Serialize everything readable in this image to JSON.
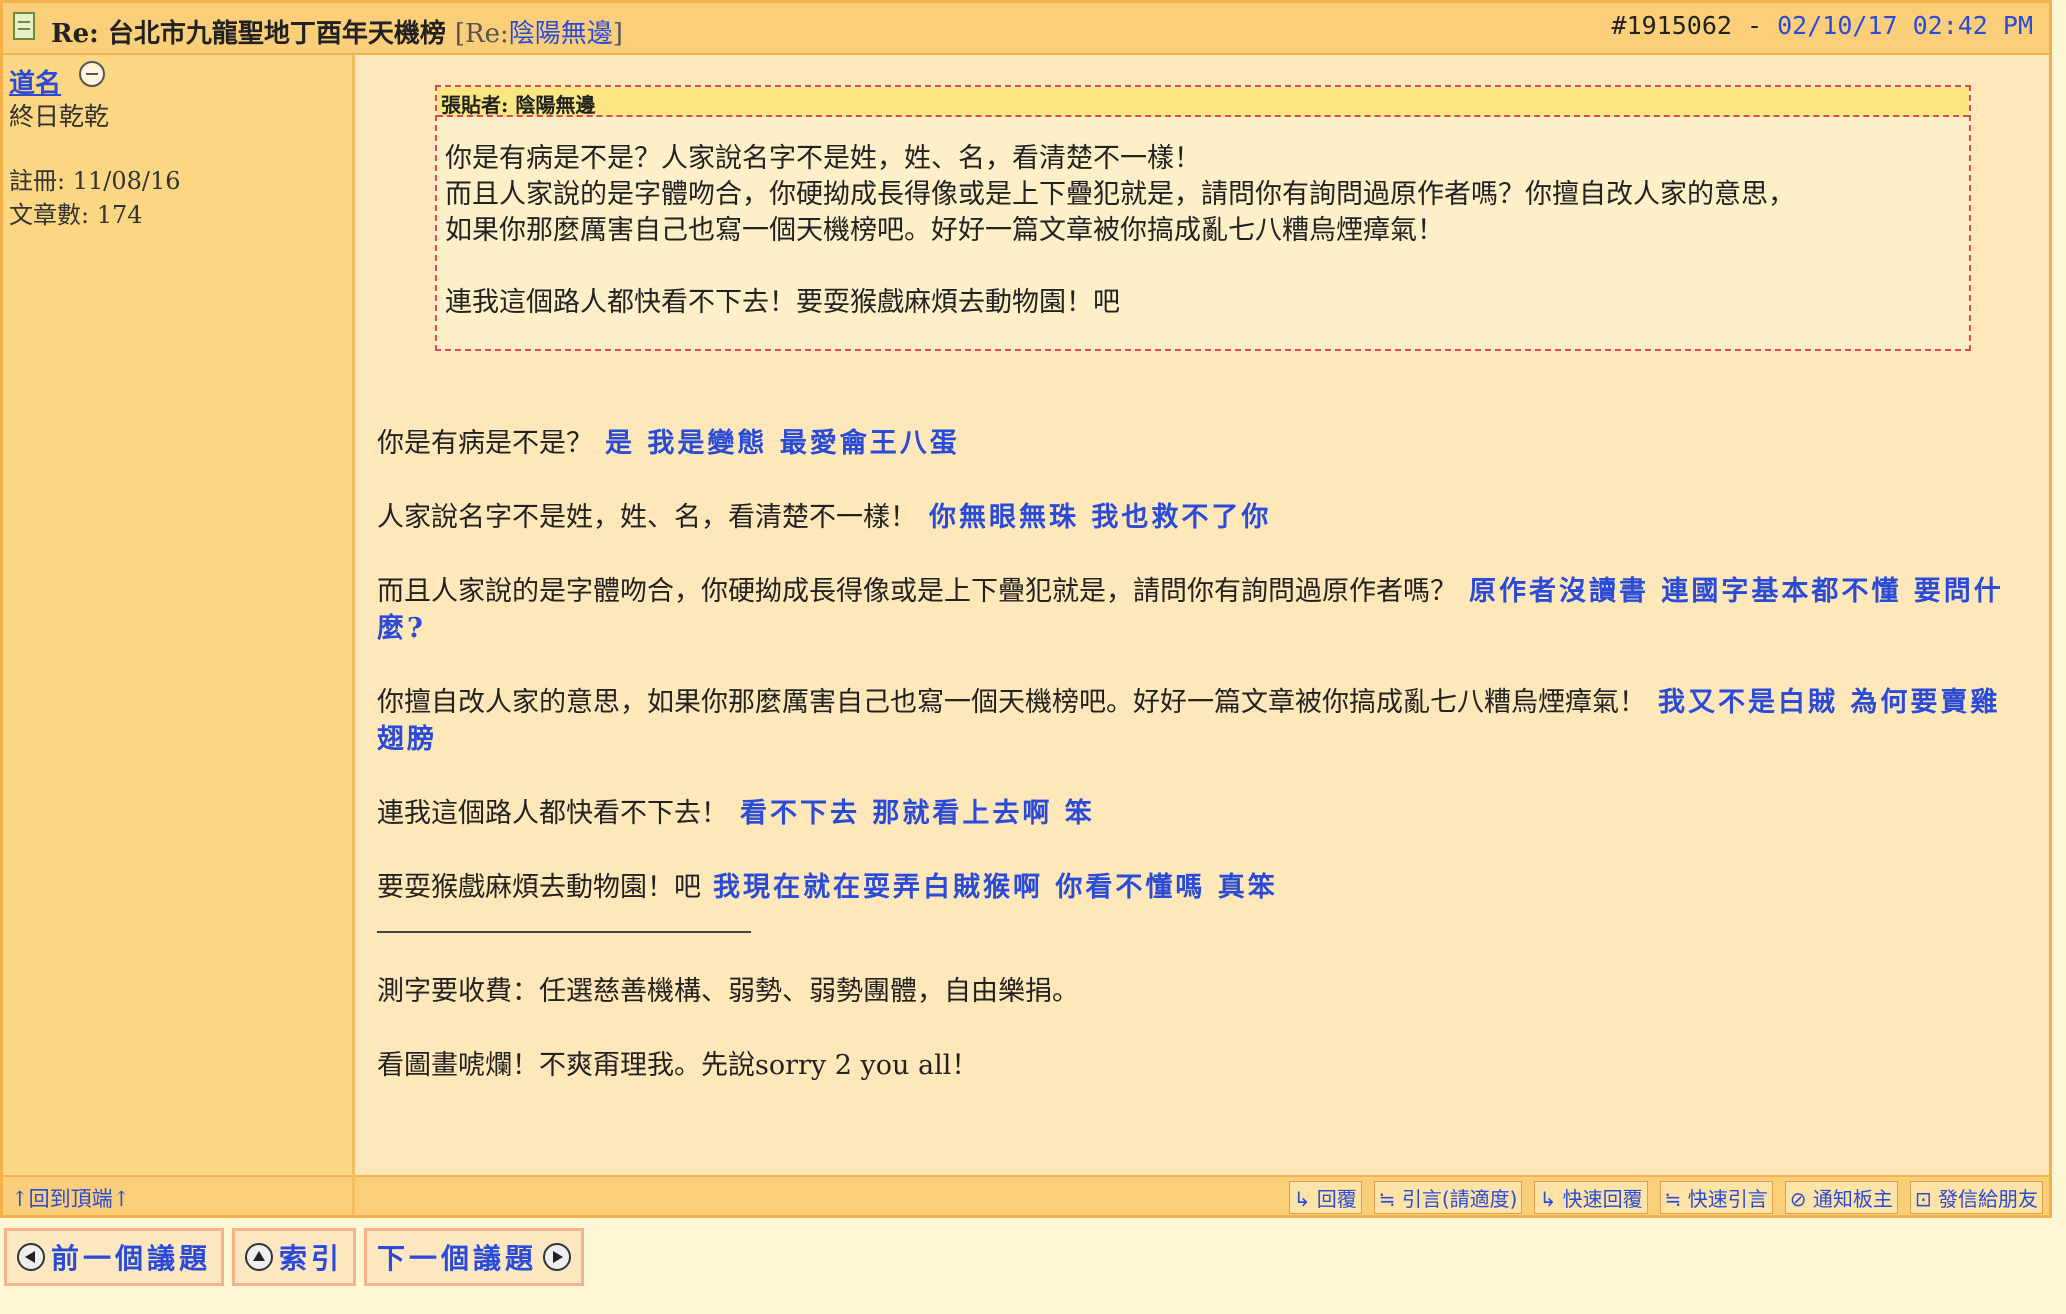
{
  "post": {
    "title_prefix": "Re:",
    "title": "台北市九龍聖地丁酉年天機榜",
    "parent_open": "[Re:",
    "parent_link": "陰陽無邊",
    "parent_close": "]",
    "post_number": "#1915062",
    "date": "02/10/17 02:42 PM"
  },
  "author": {
    "name": "道名",
    "title": "終日乾乾",
    "registered": "註冊: 11/08/16",
    "posts": "文章數: 174"
  },
  "quote": {
    "header": "張貼者: 陰陽無邊",
    "lines": [
      "你是有病是不是？人家說名字不是姓，姓、名，看清楚不一樣！",
      "而且人家說的是字體吻合，你硬拗成長得像或是上下疊犯就是，請問你有詢問過原作者嗎？你擅自改人家的意思，",
      "如果你那麼厲害自己也寫一個天機榜吧。好好一篇文章被你搞成亂七八糟烏煙瘴氣！",
      "連我這個路人都快看不下去！要耍猴戲麻煩去動物園！吧"
    ]
  },
  "replies": [
    {
      "q": "你是有病是不是？",
      "a": "是 我是變態 最愛龠王八蛋"
    },
    {
      "q": "人家說名字不是姓，姓、名，看清楚不一樣！",
      "a": "你無眼無珠 我也救不了你"
    },
    {
      "q": "而且人家說的是字體吻合，你硬拗成長得像或是上下疊犯就是，請問你有詢問過原作者嗎？",
      "a": "原作者沒讀書 連國字基本都不懂 要問什麼?"
    },
    {
      "q": "你擅自改人家的意思，如果你那麼厲害自己也寫一個天機榜吧。好好一篇文章被你搞成亂七八糟烏煙瘴氣！",
      "a": "我又不是白賊 為何要賣雞翅膀"
    },
    {
      "q": "連我這個路人都快看不下去！",
      "a": "看不下去 那就看上去啊 笨"
    },
    {
      "q": "要耍猴戲麻煩去動物園！吧",
      "a": "我現在就在耍弄白賊猴啊 你看不懂嗎 真笨"
    }
  ],
  "signature": [
    "測字要收費：任選慈善機構、弱勢、弱勢團體，自由樂捐。",
    "看圖畫唬爛！不爽甭理我。先說sorry 2 you all！"
  ],
  "footer": {
    "back_to_top": "↑回到頂端↑",
    "actions": [
      "↳ 回覆",
      "≒ 引言(請適度)",
      "↳ 快速回覆",
      "≒ 快速引言",
      "⊘ 通知板主",
      "⊡ 發信給朋友"
    ]
  },
  "nav": {
    "prev": "前一個議題",
    "index": "索引",
    "next": "下一個議題"
  },
  "colors": {
    "accent_blue": "#2a4bd7",
    "header_bg": "#fbcf79",
    "sidebar_bg": "#fbd783",
    "content_bg": "#fee8b9",
    "quote_border": "#e0455e"
  }
}
